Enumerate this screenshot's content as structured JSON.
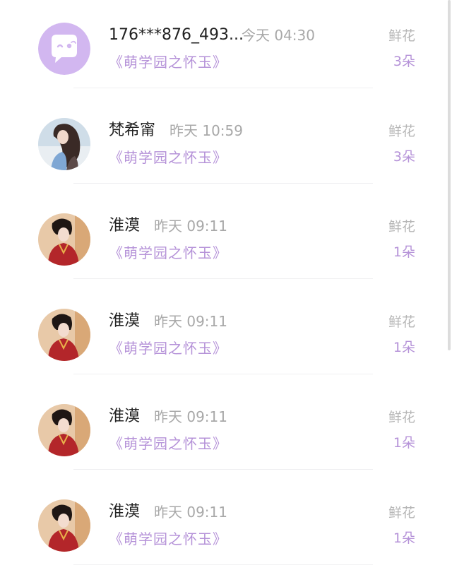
{
  "gift_list": [
    {
      "user": "176***876_493...",
      "time": "今天 04:30",
      "book": "《萌学园之怀玉》",
      "gift_type": "鲜花",
      "gift_count": "3朵",
      "avatar_icon": "default-chat-avatar-icon"
    },
    {
      "user": "梵希甯",
      "time": "昨天 10:59",
      "book": "《萌学园之怀玉》",
      "gift_type": "鲜花",
      "gift_count": "3朵",
      "avatar_icon": "user-photo-avatar"
    },
    {
      "user": "淮漠",
      "time": "昨天 09:11",
      "book": "《萌学园之怀玉》",
      "gift_type": "鲜花",
      "gift_count": "1朵",
      "avatar_icon": "user-photo-avatar"
    },
    {
      "user": "淮漠",
      "time": "昨天 09:11",
      "book": "《萌学园之怀玉》",
      "gift_type": "鲜花",
      "gift_count": "1朵",
      "avatar_icon": "user-photo-avatar"
    },
    {
      "user": "淮漠",
      "time": "昨天 09:11",
      "book": "《萌学园之怀玉》",
      "gift_type": "鲜花",
      "gift_count": "1朵",
      "avatar_icon": "user-photo-avatar"
    },
    {
      "user": "淮漠",
      "time": "昨天 09:11",
      "book": "《萌学园之怀玉》",
      "gift_type": "鲜花",
      "gift_count": "1朵",
      "avatar_icon": "user-photo-avatar"
    }
  ],
  "colors": {
    "accent": "#b592d8",
    "avatar_bg": "#d2b7f0",
    "text_primary": "#222222",
    "text_secondary": "#a8a8a8"
  }
}
